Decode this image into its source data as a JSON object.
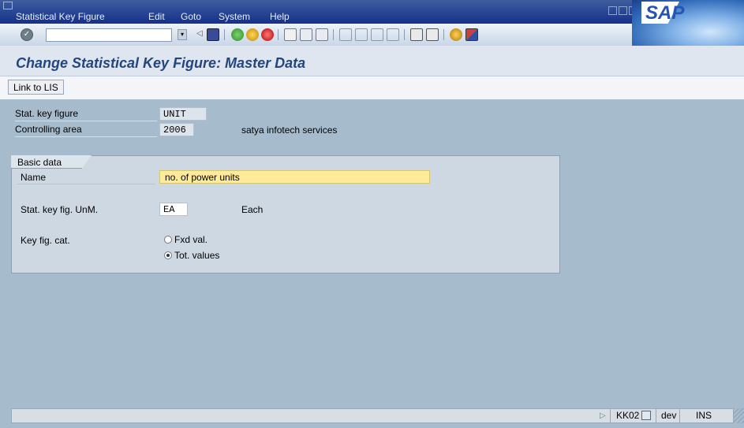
{
  "menubar": {
    "items": [
      {
        "label": "Statistical Key Figure"
      },
      {
        "label": "Edit"
      },
      {
        "label": "Goto"
      },
      {
        "label": "System"
      },
      {
        "label": "Help"
      }
    ],
    "logo_text": "SAP"
  },
  "toolbar": {
    "command_field_value": "",
    "buttons": [
      "enter",
      "back-arrow",
      "save",
      "back",
      "exit",
      "cancel",
      "print",
      "find",
      "find-next",
      "first-page",
      "previous-page",
      "next-page",
      "last-page",
      "create-session",
      "generate-shortcut",
      "help",
      "customize-layout"
    ]
  },
  "title": "Change Statistical Key Figure: Master Data",
  "app_toolbar": {
    "link_to_lis": "Link to LIS"
  },
  "header_fields": {
    "stat_key_figure": {
      "label": "Stat. key figure",
      "value": "UNIT"
    },
    "controlling_area": {
      "label": "Controlling area",
      "value": "2006",
      "description": "satya infotech services"
    }
  },
  "basic_data": {
    "group_title": "Basic data",
    "name": {
      "label": "Name",
      "value": "no. of power units"
    },
    "unit": {
      "label": "Stat. key fig. UnM.",
      "value": "EA",
      "description": "Each"
    },
    "category": {
      "label": "Key fig. cat.",
      "options": [
        {
          "label": "Fxd val.",
          "selected": false
        },
        {
          "label": "Tot. values",
          "selected": true
        }
      ]
    }
  },
  "statusbar": {
    "transaction": "KK02",
    "system": "dev",
    "mode": "INS"
  },
  "colors": {
    "menubar": "#14308a",
    "title_text": "#23467e",
    "background": "#a6bccd",
    "required_field": "#ffeb99"
  }
}
